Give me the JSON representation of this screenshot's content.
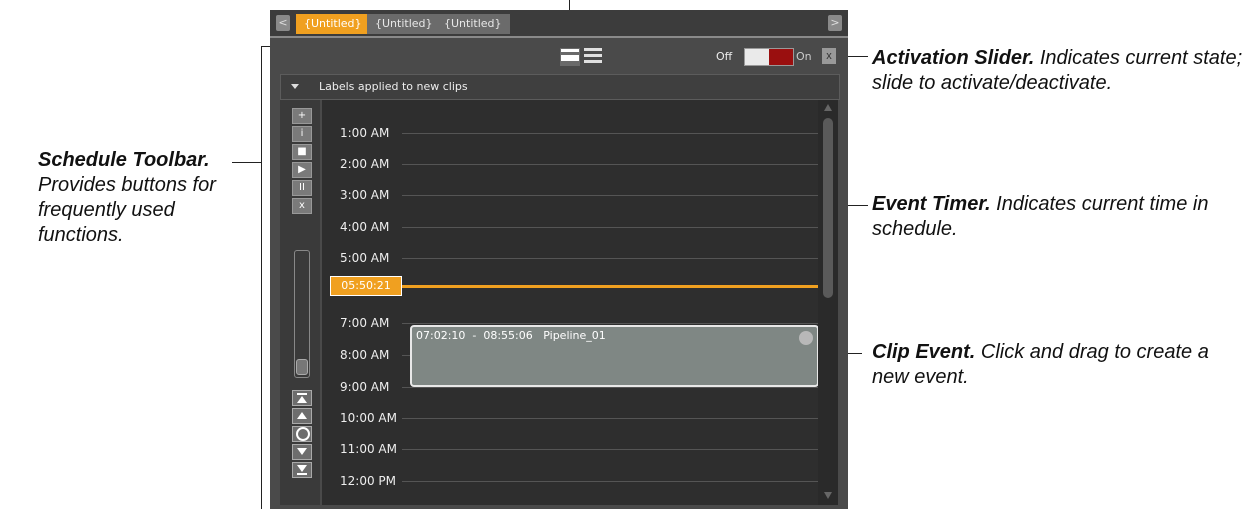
{
  "tabs": [
    {
      "label": "{Untitled}",
      "active": true
    },
    {
      "label": "{Untitled}",
      "active": false
    },
    {
      "label": "{Untitled}",
      "active": false
    }
  ],
  "tab_scroll": {
    "left": "<",
    "right": ">"
  },
  "activation": {
    "off_label": "Off",
    "on_label": "On",
    "state": "on",
    "close_glyph": "x"
  },
  "labels_bar": {
    "text": "Labels applied to new clips"
  },
  "toolbar_buttons": [
    "+",
    "i",
    "■",
    "▶",
    "II",
    "x"
  ],
  "schedule": {
    "hours": [
      "1:00 AM",
      "2:00 AM",
      "3:00 AM",
      "4:00 AM",
      "5:00 AM",
      "7:00 AM",
      "8:00 AM",
      "9:00 AM",
      "10:00 AM",
      "11:00 AM",
      "12:00 PM"
    ],
    "current_time": "05:50:21",
    "clip": {
      "text": "07:02:10  -  08:55:06   Pipeline_01"
    }
  },
  "callouts": {
    "activation": {
      "title": "Activation Slider.",
      "body": " Indicates current state; slide to activate/deactivate."
    },
    "toolbar": {
      "title": "Schedule Toolbar.",
      "body": " Provides buttons for frequently used functions."
    },
    "timer": {
      "title": "Event Timer.",
      "body": " Indicates current time in schedule."
    },
    "clip": {
      "title": "Clip Event.",
      "body": " Click and drag to create a new event."
    }
  },
  "colors": {
    "accent": "#f0a020",
    "slider_on": "#9a0f0f",
    "background": "#4a4a4a"
  }
}
